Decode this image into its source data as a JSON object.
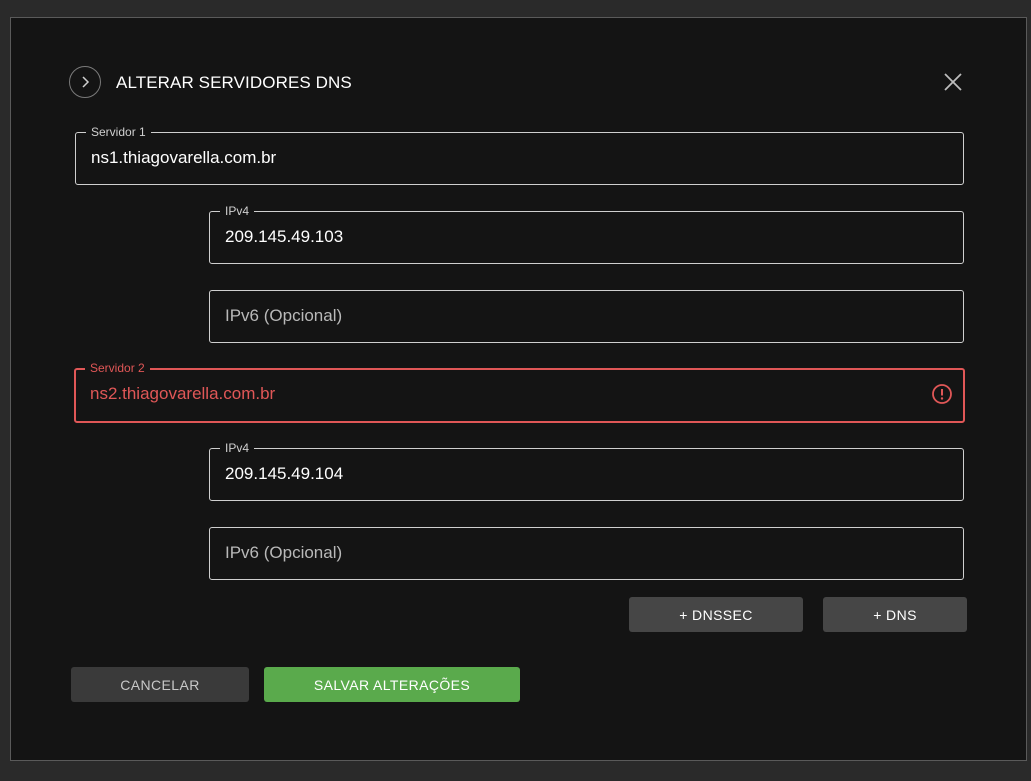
{
  "dialog": {
    "title": "ALTERAR SERVIDORES DNS"
  },
  "servers": [
    {
      "label": "Servidor 1",
      "value": "ns1.thiagovarella.com.br",
      "ipv4": {
        "label": "IPv4",
        "value": "209.145.49.103"
      },
      "ipv6": {
        "placeholder": "IPv6 (Opcional)"
      }
    },
    {
      "label": "Servidor 2",
      "value": "ns2.thiagovarella.com.br",
      "error": true,
      "ipv4": {
        "label": "IPv4",
        "value": "209.145.49.104"
      },
      "ipv6": {
        "placeholder": "IPv6 (Opcional)"
      }
    }
  ],
  "actions": {
    "add_dnssec": "+ DNSSEC",
    "add_dns": "+ DNS",
    "cancel": "CANCELAR",
    "save": "SALVAR ALTERAÇÕES"
  },
  "colors": {
    "background": "#141414",
    "error": "#e05757",
    "save": "#5aaa4c",
    "secondary_button": "#464646"
  },
  "icons": {
    "toggle": "chevron-right-icon",
    "close": "close-icon",
    "error": "error-icon"
  }
}
